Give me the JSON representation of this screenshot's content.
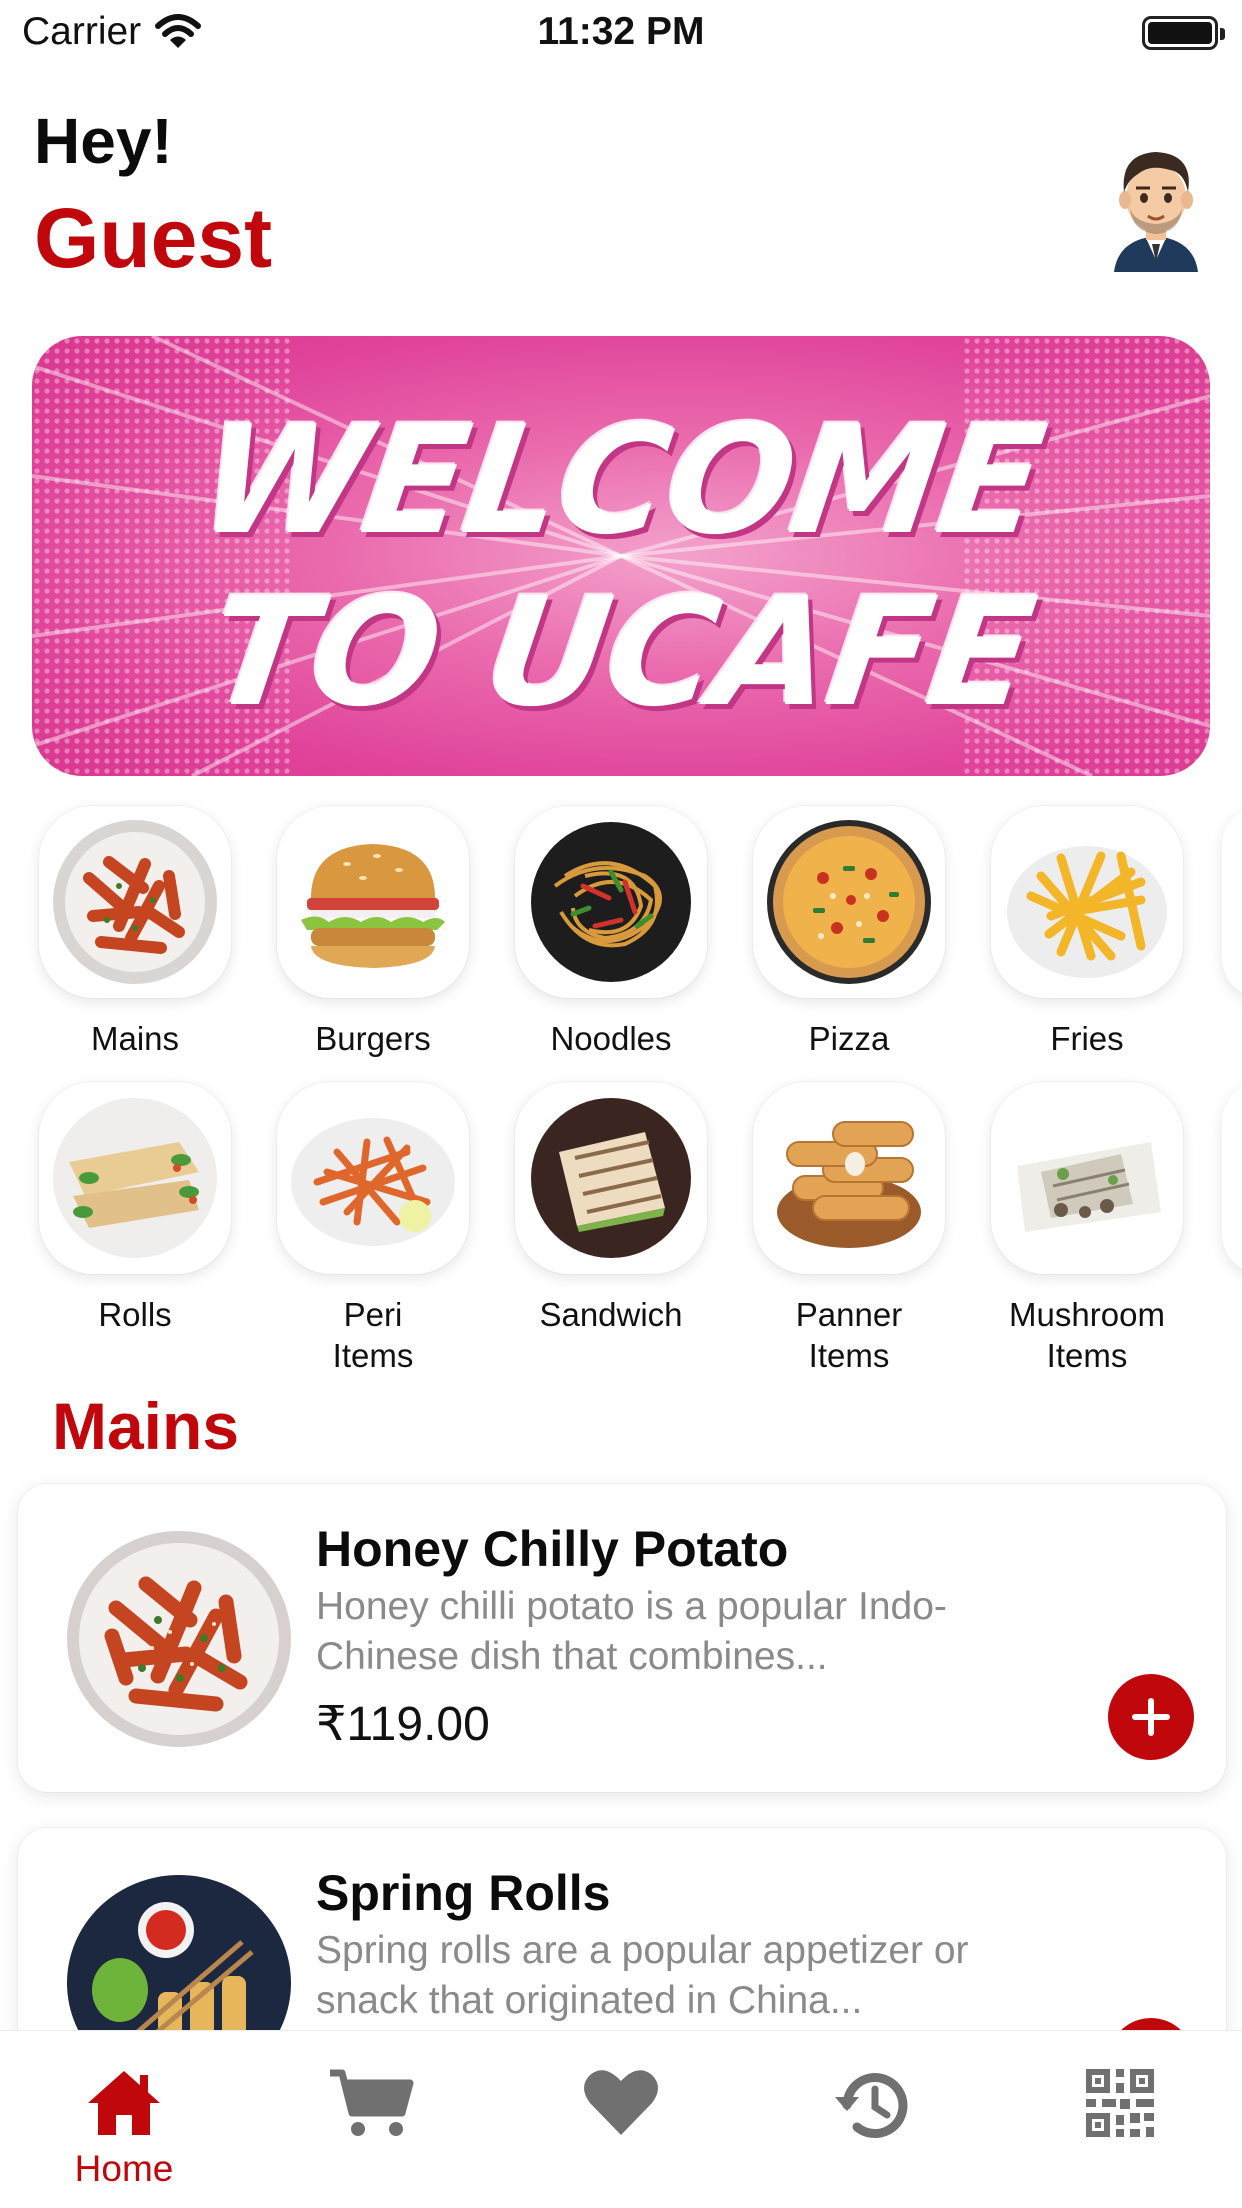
{
  "status_bar": {
    "carrier": "Carrier",
    "time": "11:32 PM"
  },
  "header": {
    "greeting": "Hey!",
    "user_name": "Guest"
  },
  "banner": {
    "line1": "WELCOME",
    "line2": "TO UCAFE"
  },
  "categories": {
    "row1": [
      {
        "label": "Mains"
      },
      {
        "label": "Burgers"
      },
      {
        "label": "Noodles"
      },
      {
        "label": "Pizza"
      },
      {
        "label": "Fries"
      }
    ],
    "row2": [
      {
        "label": "Rolls"
      },
      {
        "label": "Peri\nItems"
      },
      {
        "label": "Sandwich"
      },
      {
        "label": "Panner\nItems"
      },
      {
        "label": "Mushroom\nItems"
      }
    ]
  },
  "section": {
    "title": "Mains"
  },
  "menu_items": [
    {
      "name": "Honey Chilly Potato",
      "description": "Honey chilli potato is a popular Indo-Chinese dish that combines...",
      "price": "₹119.00"
    },
    {
      "name": "Spring Rolls",
      "description": "Spring rolls are a popular appetizer or snack that originated in China...",
      "price": ""
    }
  ],
  "tabbar": {
    "active": "home",
    "home_label": "Home",
    "icons": [
      "home-icon",
      "cart-icon",
      "heart-icon",
      "history-icon",
      "qr-code-icon"
    ]
  },
  "colors": {
    "accent": "#c0080c",
    "banner_pink": "#e0439a",
    "inactive_icon": "#707070"
  }
}
